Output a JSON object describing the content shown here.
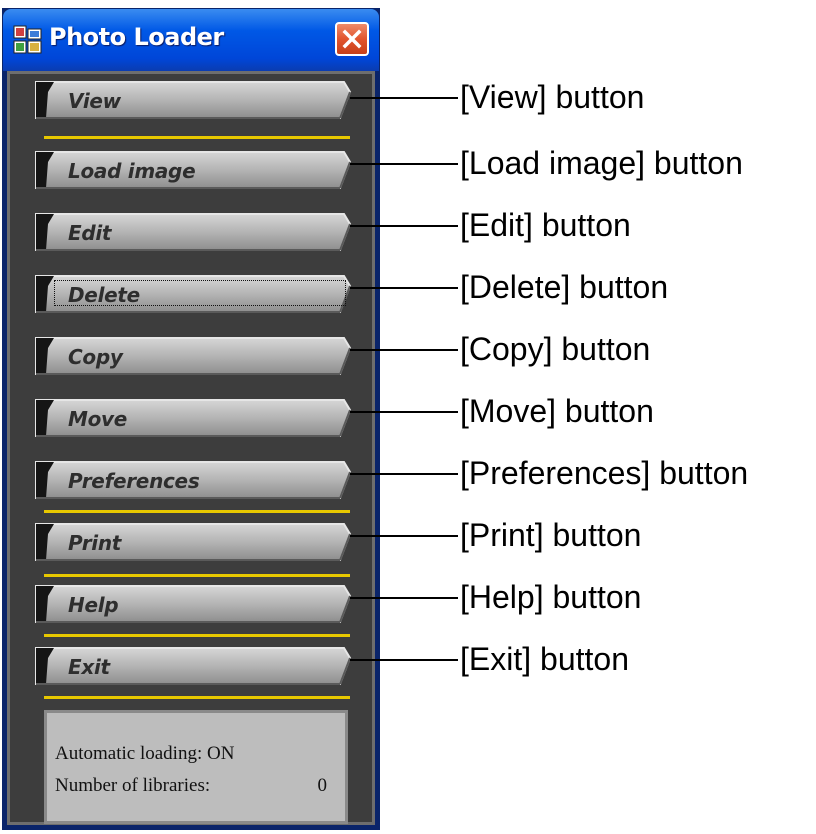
{
  "window": {
    "title": "Photo Loader"
  },
  "buttons": [
    {
      "label": "View"
    },
    {
      "label": "Load image"
    },
    {
      "label": "Edit"
    },
    {
      "label": "Delete"
    },
    {
      "label": "Copy"
    },
    {
      "label": "Move"
    },
    {
      "label": "Preferences"
    },
    {
      "label": "Print"
    },
    {
      "label": "Help"
    },
    {
      "label": "Exit"
    }
  ],
  "status": {
    "automatic_loading_label": "Automatic loading:",
    "automatic_loading_value": "ON",
    "libraries_label": "Number of libraries:",
    "libraries_value": "0"
  },
  "callouts": [
    "[View] button",
    "[Load image] button",
    "[Edit] button",
    "[Delete] button",
    "[Copy] button",
    "[Move] button",
    "[Preferences] button",
    "[Print] button",
    "[Help] button",
    "[Exit] button"
  ],
  "colors": {
    "separator": "#e8c800",
    "panel": "#3d3d3d",
    "titlebar": "#0058e6",
    "close": "#e2552e"
  },
  "icons": [
    "photo-loader-app-icon",
    "close-icon"
  ]
}
